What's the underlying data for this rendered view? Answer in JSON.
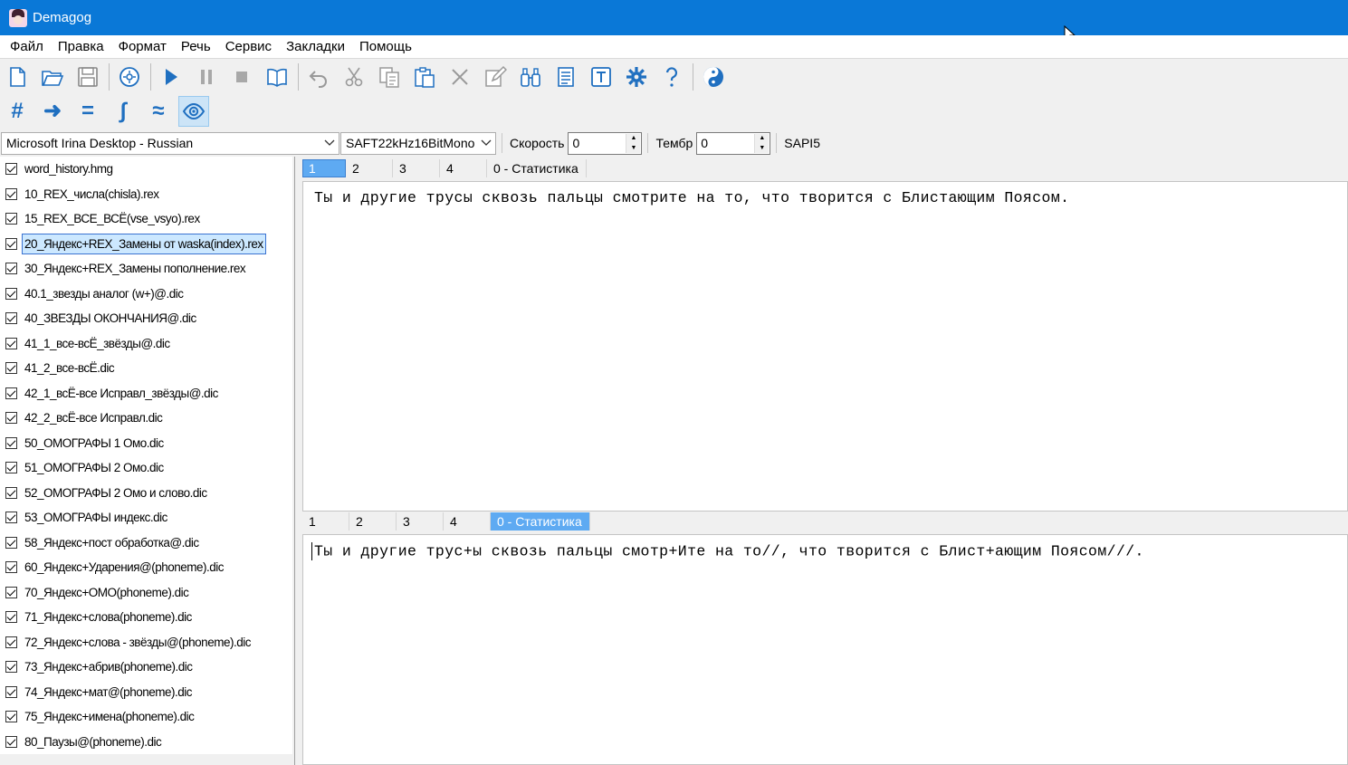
{
  "window": {
    "title": "Demagog"
  },
  "menu": [
    "Файл",
    "Правка",
    "Формат",
    "Речь",
    "Сервис",
    "Закладки",
    "Помощь"
  ],
  "toolbar1": [
    {
      "icon": "new-file-icon",
      "group": 1
    },
    {
      "icon": "open-folder-icon",
      "group": 1
    },
    {
      "icon": "save-icon",
      "group": 1
    },
    {
      "icon": "disc-icon",
      "group": 2
    },
    {
      "icon": "play-icon",
      "group": 3
    },
    {
      "icon": "pause-icon",
      "group": 3
    },
    {
      "icon": "stop-icon",
      "group": 3
    },
    {
      "icon": "book-icon",
      "group": 3
    },
    {
      "icon": "undo-icon",
      "group": 4
    },
    {
      "icon": "cut-icon",
      "group": 4
    },
    {
      "icon": "copy-icon",
      "group": 4
    },
    {
      "icon": "paste-icon",
      "group": 4
    },
    {
      "icon": "delete-icon",
      "group": 4
    },
    {
      "icon": "edit-icon",
      "group": 4
    },
    {
      "icon": "find-icon",
      "group": 4
    },
    {
      "icon": "document-icon",
      "group": 4
    },
    {
      "icon": "text-icon",
      "group": 4
    },
    {
      "icon": "settings-icon",
      "group": 4
    },
    {
      "icon": "help-icon",
      "group": 4
    },
    {
      "icon": "yin-yang-icon",
      "group": 5
    }
  ],
  "toolbar2": [
    {
      "icon": "hash-icon",
      "glyph": "#"
    },
    {
      "icon": "arrow-right-icon",
      "glyph": "➜"
    },
    {
      "icon": "equals-icon",
      "glyph": "="
    },
    {
      "icon": "integral-icon",
      "glyph": "∫"
    },
    {
      "icon": "approx-icon",
      "glyph": "≈"
    },
    {
      "icon": "eye-icon",
      "glyph": "",
      "active": true
    }
  ],
  "voice": {
    "voice_name": "Microsoft Irina Desktop - Russian",
    "format": "SAFT22kHz16BitMono",
    "speed_label": "Скорость",
    "speed_value": "0",
    "timbre_label": "Тембр",
    "timbre_value": "0",
    "engine": "SAPI5"
  },
  "files": [
    {
      "name": "word_history.hmg",
      "checked": true
    },
    {
      "name": "10_REX_числа(chisla).rex",
      "checked": true
    },
    {
      "name": "15_REX_ВСЕ_ВСЁ(vse_vsyo).rex",
      "checked": true
    },
    {
      "name": "20_Яндекс+REX_Замены от waska(index).rex",
      "checked": true,
      "selected": true
    },
    {
      "name": "30_Яндекс+REX_Замены пополнение.rex",
      "checked": true
    },
    {
      "name": "40.1_звезды аналог (w+)@.dic",
      "checked": true
    },
    {
      "name": "40_ЗВЕЗДЫ ОКОНЧАНИЯ@.dic",
      "checked": true
    },
    {
      "name": "41_1_все-всЁ_звёзды@.dic",
      "checked": true
    },
    {
      "name": "41_2_все-всЁ.dic",
      "checked": true
    },
    {
      "name": "42_1_всЁ-все Исправл_звёзды@.dic",
      "checked": true
    },
    {
      "name": "42_2_всЁ-все Исправл.dic",
      "checked": true
    },
    {
      "name": "50_ОМОГРАФЫ 1 Омо.dic",
      "checked": true
    },
    {
      "name": "51_ОМОГРАФЫ 2 Омо.dic",
      "checked": true
    },
    {
      "name": "52_ОМОГРАФЫ 2 Омо и слово.dic",
      "checked": true
    },
    {
      "name": "53_ОМОГРАФЫ индекс.dic",
      "checked": true
    },
    {
      "name": "58_Яндекс+пост обработка@.dic",
      "checked": true
    },
    {
      "name": "60_Яндекс+Ударения@(phoneme).dic",
      "checked": true
    },
    {
      "name": "70_Яндекс+ОМО(phoneme).dic",
      "checked": true
    },
    {
      "name": "71_Яндекс+слова(phoneme).dic",
      "checked": true
    },
    {
      "name": "72_Яндекс+слова - звёзды@(phoneme).dic",
      "checked": true
    },
    {
      "name": "73_Яндекс+абрив(phoneme).dic",
      "checked": true
    },
    {
      "name": "74_Яндекс+мат@(phoneme).dic",
      "checked": true
    },
    {
      "name": "75_Яндекс+имена(phoneme).dic",
      "checked": true
    },
    {
      "name": "80_Паузы@(phoneme).dic",
      "checked": true
    }
  ],
  "tabs_top": [
    {
      "label": "1",
      "active": true
    },
    {
      "label": "2"
    },
    {
      "label": "3"
    },
    {
      "label": "4"
    },
    {
      "label": "0 - Статистика"
    }
  ],
  "tabs_bottom": [
    {
      "label": "1"
    },
    {
      "label": "2"
    },
    {
      "label": "3"
    },
    {
      "label": "4"
    },
    {
      "label": "0 - Статистика",
      "active": true
    }
  ],
  "editor_top_text": "Ты и другие трусы сквозь пальцы смотрите на то, что творится с Блистающим Поясом.",
  "editor_bottom_text": "Ты и другие трус+ы сквозь пальцы смотр+Ите на то//, что творится с Блист+ающим Поясом///.",
  "colors": {
    "titlebar": "#0a78d7",
    "accent": "#1f6fc0",
    "tab_active": "#5eaaf2"
  }
}
